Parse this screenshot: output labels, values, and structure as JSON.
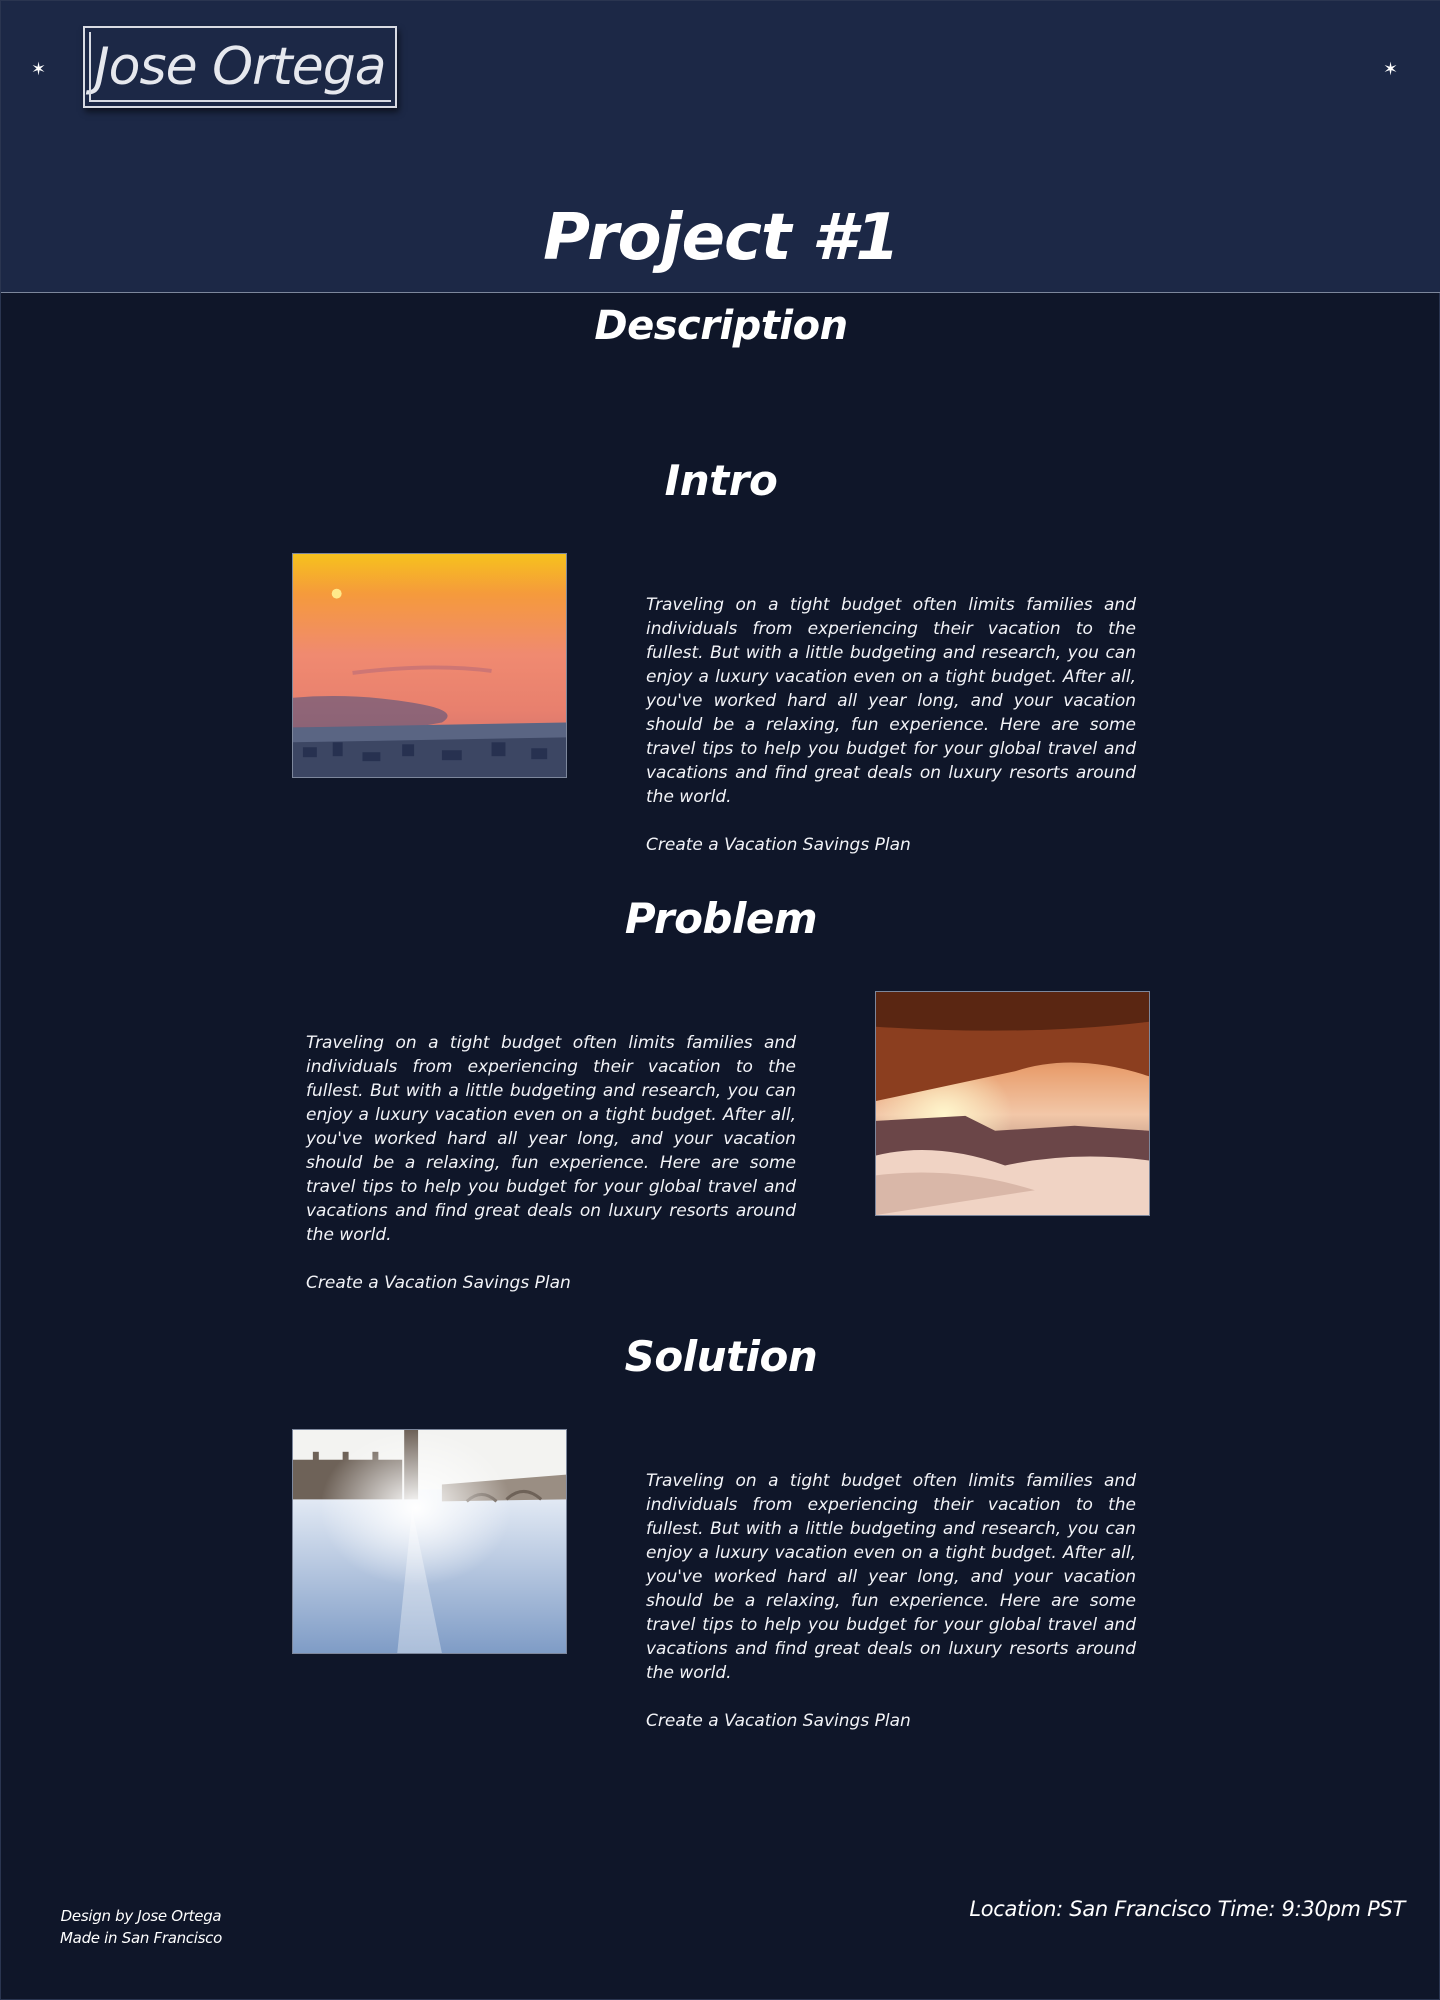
{
  "header": {
    "logo": "Jose Ortega",
    "star_glyph": "✶"
  },
  "page": {
    "title": "Project #1",
    "subtitle": "Description"
  },
  "sections": [
    {
      "title": "Intro",
      "image_alt": "sunset over coastline aerial view",
      "body": "Traveling on a tight budget often limits families and individuals from experiencing their vacation to the fullest. But with a little budgeting and research, you can enjoy a luxury vacation even on a tight budget. After all, you've worked hard all year long, and your vacation should be a relaxing, fun experience. Here are some travel tips to help you budget for your global travel and vacations and find great deals on luxury resorts around the world.",
      "link": "Create a Vacation Savings Plan"
    },
    {
      "title": "Problem",
      "image_alt": "sunrise through a rock arch",
      "body": "Traveling on a tight budget often limits families and individuals from experiencing their vacation to the fullest. But with a little budgeting and research, you can enjoy a luxury vacation even on a tight budget. After all, you've worked hard all year long, and your vacation should be a relaxing, fun experience. Here are some travel tips to help you budget for your global travel and vacations and find great deals on luxury resorts around the world.",
      "link": "Create a Vacation Savings Plan"
    },
    {
      "title": "Solution",
      "image_alt": "river and bridge by clock tower",
      "body": "Traveling on a tight budget often limits families and individuals from experiencing their vacation to the fullest. But with a little budgeting and research, you can enjoy a luxury vacation even on a tight budget. After all, you've worked hard all year long, and your vacation should be a relaxing, fun experience. Here are some travel tips to help you budget for your global travel and vacations and find great deals on luxury resorts around the world.",
      "link": "Create a Vacation Savings Plan"
    }
  ],
  "footer": {
    "credit_line1": "Design by Jose Ortega",
    "credit_line2": "Made in San Francisco",
    "location": "Location: San Francisco Time: 9:30pm PST"
  },
  "colors": {
    "header_bg": "#1c2846",
    "body_bg": "#0f1629",
    "text": "#ffffff"
  }
}
